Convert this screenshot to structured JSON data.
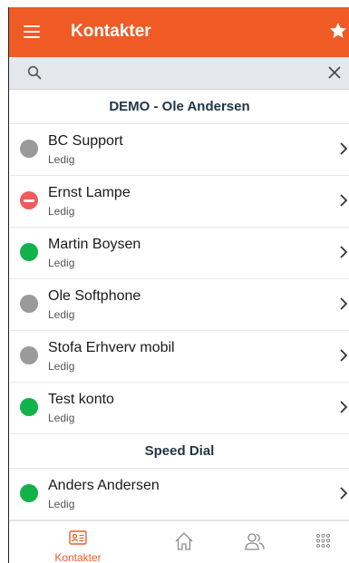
{
  "appbar": {
    "title": "Kontakter",
    "accent_color": "#f05a25",
    "menu_icon": "hamburger-menu-icon",
    "favorite_icon": "star-icon"
  },
  "search": {
    "value": "",
    "placeholder": "",
    "search_icon": "search-icon",
    "clear_icon": "close-icon"
  },
  "sections": [
    {
      "title": "DEMO - Ole Andersen",
      "contacts": [
        {
          "name": "BC Support",
          "status": "Ledig",
          "presence": "grey"
        },
        {
          "name": "Ernst Lampe",
          "status": "Ledig",
          "presence": "red"
        },
        {
          "name": "Martin Boysen",
          "status": "Ledig",
          "presence": "green"
        },
        {
          "name": "Ole Softphone",
          "status": "Ledig",
          "presence": "grey"
        },
        {
          "name": "Stofa Erhverv mobil",
          "status": "Ledig",
          "presence": "grey"
        },
        {
          "name": "Test konto",
          "status": "Ledig",
          "presence": "green"
        }
      ]
    },
    {
      "title": "Speed Dial",
      "contacts": [
        {
          "name": "Anders Andersen",
          "status": "Ledig",
          "presence": "green"
        }
      ]
    }
  ],
  "tabbar": {
    "tabs": [
      {
        "label": "Kontakter",
        "icon": "contact-card-icon",
        "active": true
      },
      {
        "label": "",
        "icon": "home-icon",
        "active": false
      },
      {
        "label": "",
        "icon": "users-icon",
        "active": false
      },
      {
        "label": "",
        "icon": "dialpad-icon",
        "active": false
      }
    ]
  },
  "colors": {
    "presence_green": "#12b24a",
    "presence_grey": "#9a9a9a",
    "presence_red": "#f25a5a",
    "section_title": "#1f3548"
  }
}
